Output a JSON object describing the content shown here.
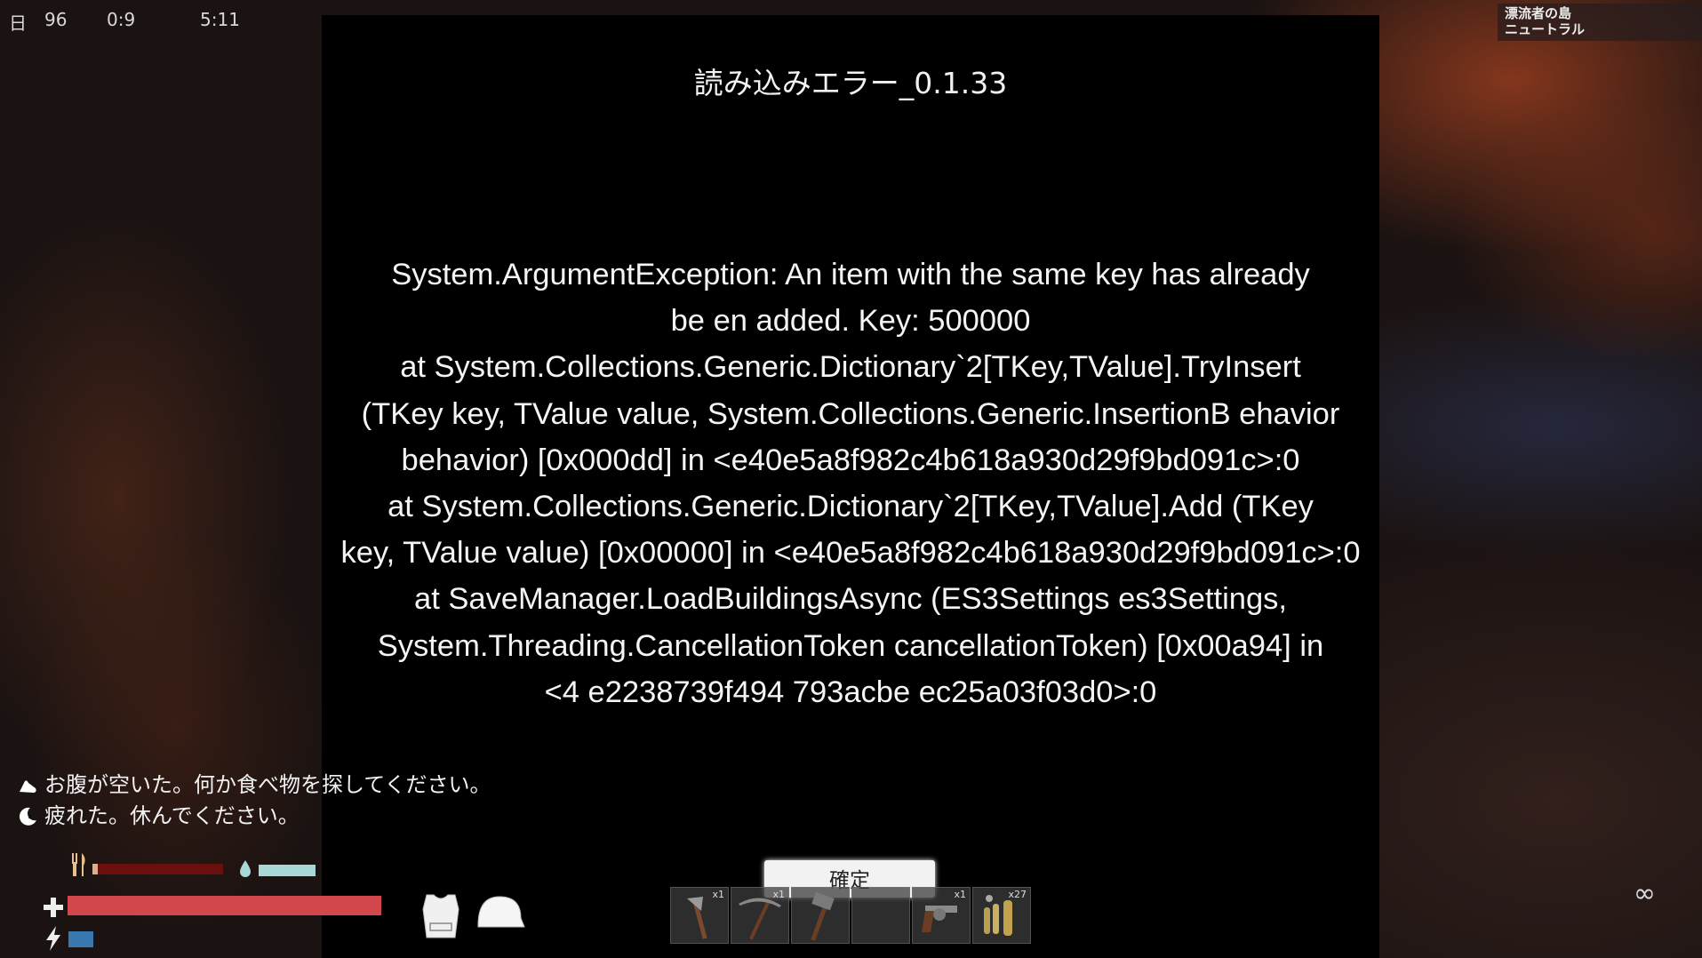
{
  "hud": {
    "day_label": "日",
    "day_count": "96",
    "clock_a": "0:9",
    "clock_b": "5:11"
  },
  "region": {
    "name": "漂流者の島",
    "status": "ニュートラル"
  },
  "dialog": {
    "title": "読み込みエラー_0.1.33",
    "error_lines": [
      "System.ArgumentException: An item with the same key has already",
      "be en added. Key: 500000",
      "at System.Collections.Generic.Dictionary`2[TKey,TValue].TryInsert",
      "(TKey key, TValue value, System.Collections.Generic.InsertionB ehavior",
      "behavior) [0x000dd] in <e40e5a8f982c4b618a930d29f9bd091c>:0",
      "at System.Collections.Generic.Dictionary`2[TKey,TValue].Add (TKey",
      "key, TValue value) [0x00000] in <e40e5a8f982c4b618a930d29f9bd091c>:0",
      "at SaveManager.LoadBuildingsAsync (ES3Settings es3Settings,",
      "System.Threading.CancellationToken cancellationToken) [0x00a94] in",
      "<4 e2238739f494 793acbe ec25a03f03d0>:0"
    ],
    "confirm_label": "確定"
  },
  "messages": [
    {
      "icon": "stomach-icon",
      "text": "お腹が空いた。何か食べ物を探してください。"
    },
    {
      "icon": "moon-sleep-icon",
      "text": "疲れた。休んでください。"
    }
  ],
  "stats": {
    "food_level": 0.04,
    "water_level": 0.32,
    "health_level": 0.98,
    "energy_level": 0.28,
    "colors": {
      "food_bg": "#6a0e0e",
      "food": "#d8b08c",
      "water": "#a8d8d6",
      "health": "#d2474b",
      "energy": "#3a78b0"
    }
  },
  "equipment": [
    {
      "icon": "vest-icon"
    },
    {
      "icon": "helmet-icon"
    }
  ],
  "hotbar": [
    {
      "icon": "axe-icon",
      "qty": "x1"
    },
    {
      "icon": "pickaxe-icon",
      "qty": "x1"
    },
    {
      "icon": "hammer-icon",
      "qty": ""
    },
    {
      "icon": "empty-slot",
      "qty": ""
    },
    {
      "icon": "revolver-icon",
      "qty": "x1"
    },
    {
      "icon": "bullets-icon",
      "qty": "x27"
    }
  ],
  "ammo_display": "∞"
}
